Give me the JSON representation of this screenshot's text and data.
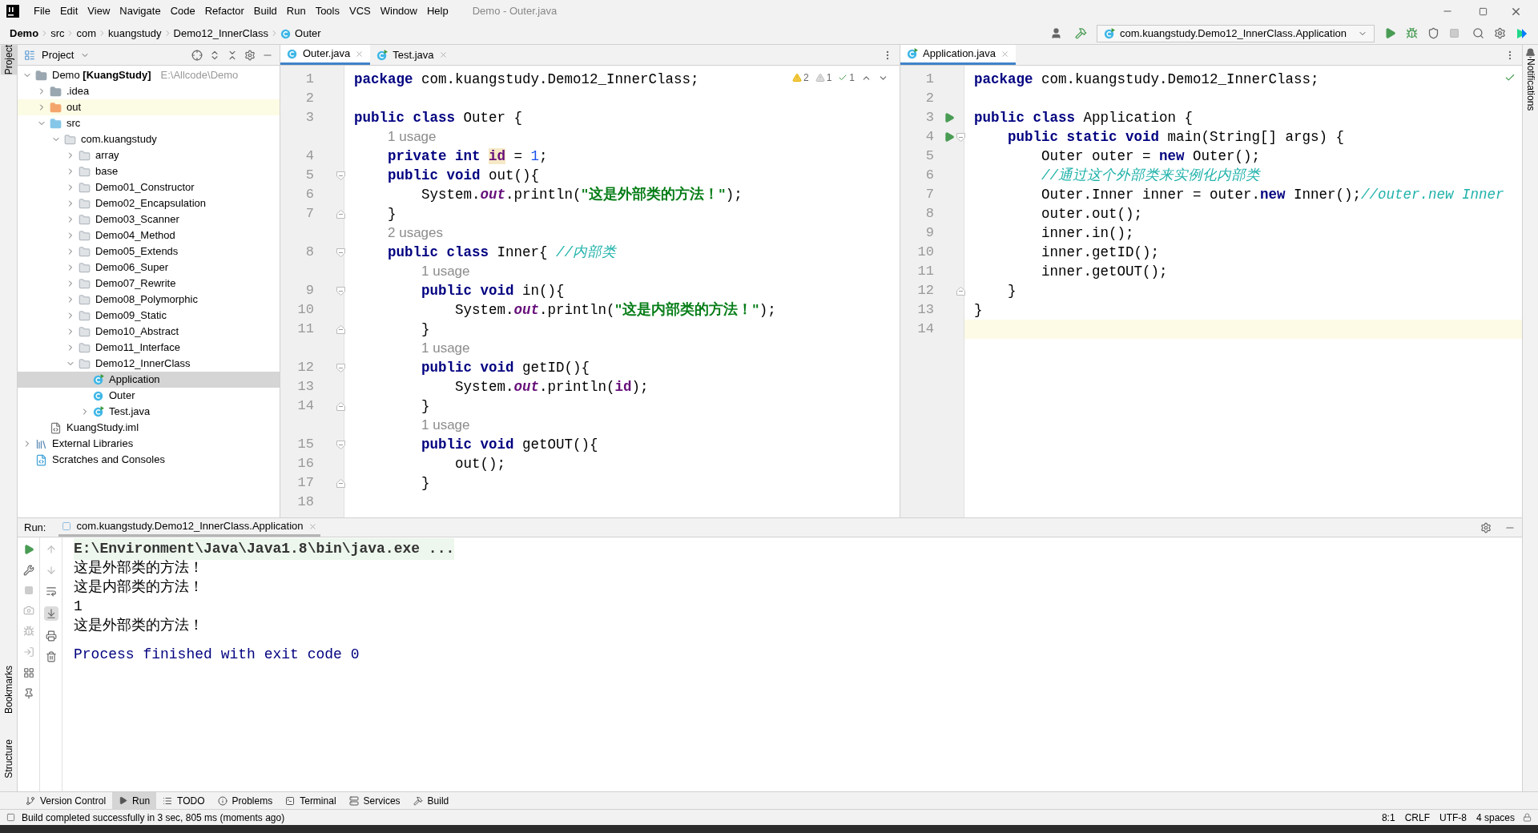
{
  "window": {
    "title": "Demo - Outer.java"
  },
  "menu": [
    "File",
    "Edit",
    "View",
    "Navigate",
    "Code",
    "Refactor",
    "Build",
    "Run",
    "Tools",
    "VCS",
    "Window",
    "Help"
  ],
  "breadcrumbs": [
    {
      "label": "Demo",
      "kind": "project"
    },
    {
      "label": "src",
      "kind": "plain"
    },
    {
      "label": "com",
      "kind": "plain"
    },
    {
      "label": "kuangstudy",
      "kind": "plain"
    },
    {
      "label": "Demo12_InnerClass",
      "kind": "plain"
    },
    {
      "label": "Outer",
      "kind": "class"
    }
  ],
  "run_config": "com.kuangstudy.Demo12_InnerClass.Application",
  "side_tabs": {
    "left_top": [
      {
        "label": "Project",
        "selected": true
      }
    ],
    "left_bottom": [
      {
        "label": "Bookmarks",
        "selected": false
      },
      {
        "label": "Structure",
        "selected": false
      }
    ],
    "right": [
      {
        "label": "Notifications",
        "selected": false
      }
    ]
  },
  "project": {
    "title": "Project",
    "tree": [
      {
        "name": "Demo **[KuangStudy]**",
        "path": "E:\\Allcode\\Demo",
        "kind": "module",
        "expanded": true,
        "selected": false,
        "children": [
          {
            "name": ".idea",
            "kind": "folder",
            "expanded": false,
            "selected": false
          },
          {
            "name": "out",
            "kind": "excluded",
            "expanded": false,
            "selected": false
          },
          {
            "name": "src",
            "kind": "source",
            "expanded": true,
            "selected": false,
            "children": [
              {
                "name": "com.kuangstudy",
                "kind": "package",
                "expanded": true,
                "selected": false,
                "children": [
                  {
                    "name": "array",
                    "kind": "package",
                    "expanded": false,
                    "selected": false
                  },
                  {
                    "name": "base",
                    "kind": "package",
                    "expanded": false,
                    "selected": false
                  },
                  {
                    "name": "Demo01_Constructor",
                    "kind": "package",
                    "expanded": false,
                    "selected": false
                  },
                  {
                    "name": "Demo02_Encapsulation",
                    "kind": "package",
                    "expanded": false,
                    "selected": false
                  },
                  {
                    "name": "Demo03_Scanner",
                    "kind": "package",
                    "expanded": false,
                    "selected": false
                  },
                  {
                    "name": "Demo04_Method",
                    "kind": "package",
                    "expanded": false,
                    "selected": false
                  },
                  {
                    "name": "Demo05_Extends",
                    "kind": "package",
                    "expanded": false,
                    "selected": false
                  },
                  {
                    "name": "Demo06_Super",
                    "kind": "package",
                    "expanded": false,
                    "selected": false
                  },
                  {
                    "name": "Demo07_Rewrite",
                    "kind": "package",
                    "expanded": false,
                    "selected": false
                  },
                  {
                    "name": "Demo08_Polymorphic",
                    "kind": "package",
                    "expanded": false,
                    "selected": false
                  },
                  {
                    "name": "Demo09_Static",
                    "kind": "package",
                    "expanded": false,
                    "selected": false
                  },
                  {
                    "name": "Demo10_Abstract",
                    "kind": "package",
                    "expanded": false,
                    "selected": false
                  },
                  {
                    "name": "Demo11_Interface",
                    "kind": "package",
                    "expanded": false,
                    "selected": false
                  },
                  {
                    "name": "Demo12_InnerClass",
                    "kind": "package",
                    "expanded": true,
                    "selected": false,
                    "children": [
                      {
                        "name": "Application",
                        "kind": "runnable",
                        "selected": true
                      },
                      {
                        "name": "Outer",
                        "kind": "class",
                        "selected": false
                      },
                      {
                        "name": "Test.java",
                        "kind": "runnable",
                        "expanded": false,
                        "selected": false
                      }
                    ]
                  }
                ]
              }
            ]
          },
          {
            "name": "KuangStudy.iml",
            "kind": "iml",
            "selected": false
          }
        ]
      },
      {
        "name": "External Libraries",
        "kind": "libraries",
        "expanded": false,
        "selected": false
      },
      {
        "name": "Scratches and Consoles",
        "kind": "scratches",
        "selected": false
      }
    ]
  },
  "left_editor": {
    "tabs": [
      {
        "label": "Outer.java",
        "kind": "class",
        "selected": true
      },
      {
        "label": "Test.java",
        "kind": "runnable",
        "selected": false
      }
    ],
    "inspections": [
      {
        "kind": "warning",
        "count": "2"
      },
      {
        "kind": "weak",
        "count": "1"
      },
      {
        "kind": "typo",
        "count": "1"
      }
    ],
    "lines": [
      {
        "num": "1",
        "tokens": [
          {
            "text": "package",
            "kind": "kw"
          },
          {
            "text": " com.kuangstudy.Demo12_InnerClass;",
            "kind": "plain"
          }
        ]
      },
      {
        "num": "2"
      },
      {
        "num": "3",
        "tokens": [
          {
            "text": "public class",
            "kind": "kw"
          },
          {
            "text": " Outer {",
            "kind": "plain"
          }
        ]
      },
      {
        "hint": "    1 usage"
      },
      {
        "num": "4",
        "tokens": [
          {
            "text": "    private int ",
            "kind": "kw"
          },
          {
            "text": "id",
            "kind": "fieldhl"
          },
          {
            "text": " = ",
            "kind": "plain"
          },
          {
            "text": "1",
            "kind": "num"
          },
          {
            "text": ";",
            "kind": "plain"
          }
        ]
      },
      {
        "num": "5",
        "fold": {
          "kind": "open"
        },
        "tokens": [
          {
            "text": "    public void",
            "kind": "kw"
          },
          {
            "text": " out(){",
            "kind": "plain"
          }
        ]
      },
      {
        "num": "6",
        "tokens": [
          {
            "text": "        System.",
            "kind": "plain"
          },
          {
            "text": "out",
            "kind": "static"
          },
          {
            "text": ".println(",
            "kind": "plain"
          },
          {
            "text": "\"这是外部类的方法！\"",
            "kind": "str"
          },
          {
            "text": ");",
            "kind": "plain"
          }
        ]
      },
      {
        "num": "7",
        "fold": {
          "kind": "close"
        },
        "tokens": [
          {
            "text": "    }",
            "kind": "plain"
          }
        ]
      },
      {
        "hint": "    2 usages"
      },
      {
        "num": "8",
        "fold": {
          "kind": "open"
        },
        "tokens": [
          {
            "text": "    public class",
            "kind": "kw"
          },
          {
            "text": " Inner{ ",
            "kind": "plain"
          },
          {
            "text": "//内部类",
            "kind": "comment"
          }
        ]
      },
      {
        "hint": "        1 usage"
      },
      {
        "num": "9",
        "fold": {
          "kind": "open"
        },
        "tokens": [
          {
            "text": "        public void",
            "kind": "kw"
          },
          {
            "text": " in(){",
            "kind": "plain"
          }
        ]
      },
      {
        "num": "10",
        "tokens": [
          {
            "text": "            System.",
            "kind": "plain"
          },
          {
            "text": "out",
            "kind": "static"
          },
          {
            "text": ".println(",
            "kind": "plain"
          },
          {
            "text": "\"这是内部类的方法！\"",
            "kind": "str"
          },
          {
            "text": ");",
            "kind": "plain"
          }
        ]
      },
      {
        "num": "11",
        "fold": {
          "kind": "close"
        },
        "tokens": [
          {
            "text": "        }",
            "kind": "plain"
          }
        ]
      },
      {
        "hint": "        1 usage"
      },
      {
        "num": "12",
        "fold": {
          "kind": "open"
        },
        "tokens": [
          {
            "text": "        public void",
            "kind": "kw"
          },
          {
            "text": " getID(){",
            "kind": "plain"
          }
        ]
      },
      {
        "num": "13",
        "tokens": [
          {
            "text": "            System.",
            "kind": "plain"
          },
          {
            "text": "out",
            "kind": "static"
          },
          {
            "text": ".println(",
            "kind": "plain"
          },
          {
            "text": "id",
            "kind": "field"
          },
          {
            "text": ");",
            "kind": "plain"
          }
        ]
      },
      {
        "num": "14",
        "fold": {
          "kind": "close"
        },
        "tokens": [
          {
            "text": "        }",
            "kind": "plain"
          }
        ]
      },
      {
        "hint": "        1 usage"
      },
      {
        "num": "15",
        "fold": {
          "kind": "open"
        },
        "tokens": [
          {
            "text": "        public void",
            "kind": "kw"
          },
          {
            "text": " getOUT(){",
            "kind": "plain"
          }
        ]
      },
      {
        "num": "16",
        "tokens": [
          {
            "text": "            out();",
            "kind": "plain"
          }
        ]
      },
      {
        "num": "17",
        "fold": {
          "kind": "close"
        },
        "tokens": [
          {
            "text": "        }",
            "kind": "plain"
          }
        ]
      },
      {
        "num": "18"
      }
    ]
  },
  "right_editor": {
    "tabs": [
      {
        "label": "Application.java",
        "kind": "runnable",
        "selected": true
      }
    ],
    "lines": [
      {
        "num": "1",
        "tokens": [
          {
            "text": "package",
            "kind": "kw"
          },
          {
            "text": " com.kuangstudy.Demo12_InnerClass;",
            "kind": "plain"
          }
        ]
      },
      {
        "num": "2"
      },
      {
        "num": "3",
        "run": true,
        "tokens": [
          {
            "text": "public class",
            "kind": "kw"
          },
          {
            "text": " Application {",
            "kind": "plain"
          }
        ]
      },
      {
        "num": "4",
        "run": true,
        "fold": {
          "kind": "open"
        },
        "tokens": [
          {
            "text": "    public static void",
            "kind": "kw"
          },
          {
            "text": " main(String[] args) {",
            "kind": "plain"
          }
        ]
      },
      {
        "num": "5",
        "tokens": [
          {
            "text": "        Outer outer = ",
            "kind": "plain"
          },
          {
            "text": "new",
            "kind": "kw"
          },
          {
            "text": " Outer();",
            "kind": "plain"
          }
        ]
      },
      {
        "num": "6",
        "tokens": [
          {
            "text": "        //通过这个外部类来实例化内部类",
            "kind": "comment"
          }
        ]
      },
      {
        "num": "7",
        "tokens": [
          {
            "text": "        Outer.Inner inner = outer.",
            "kind": "plain"
          },
          {
            "text": "new",
            "kind": "kw"
          },
          {
            "text": " Inner();",
            "kind": "plain"
          },
          {
            "text": "//outer.new Inner",
            "kind": "comment"
          }
        ]
      },
      {
        "num": "8",
        "tokens": [
          {
            "text": "        outer.out();",
            "kind": "plain"
          }
        ]
      },
      {
        "num": "9",
        "tokens": [
          {
            "text": "        inner.in();",
            "kind": "plain"
          }
        ]
      },
      {
        "num": "10",
        "tokens": [
          {
            "text": "        inner.getID();",
            "kind": "plain"
          }
        ]
      },
      {
        "num": "11",
        "tokens": [
          {
            "text": "        inner.getOUT();",
            "kind": "plain"
          }
        ]
      },
      {
        "num": "12",
        "fold": {
          "kind": "close"
        },
        "tokens": [
          {
            "text": "    }",
            "kind": "plain"
          }
        ]
      },
      {
        "num": "13",
        "tokens": [
          {
            "text": "}",
            "kind": "plain"
          }
        ]
      },
      {
        "num": "14",
        "current": true
      }
    ]
  },
  "run_panel": {
    "label": "Run:",
    "tab": "com.kuangstudy.Demo12_InnerClass.Application",
    "output": [
      {
        "kind": "command",
        "text": "E:\\Environment\\Java\\Java1.8\\bin\\java.exe ..."
      },
      {
        "kind": "stdout",
        "text": "这是外部类的方法！"
      },
      {
        "kind": "stdout",
        "text": "这是内部类的方法！"
      },
      {
        "kind": "stdout",
        "text": "1"
      },
      {
        "kind": "stdout",
        "text": "这是外部类的方法！"
      },
      {
        "kind": "exit",
        "text": "Process finished with exit code 0"
      }
    ]
  },
  "tool_tabs": [
    {
      "label": "Version Control",
      "kind": "vcs",
      "selected": false
    },
    {
      "label": "Run",
      "kind": "run",
      "selected": true
    },
    {
      "label": "TODO",
      "kind": "todo",
      "selected": false
    },
    {
      "label": "Problems",
      "kind": "problems",
      "selected": false
    },
    {
      "label": "Terminal",
      "kind": "terminal",
      "selected": false
    },
    {
      "label": "Services",
      "kind": "services",
      "selected": false
    },
    {
      "label": "Build",
      "kind": "build",
      "selected": false
    }
  ],
  "status_bar": {
    "message": "Build completed successfully in 3 sec, 805 ms (moments ago)",
    "items": [
      "8:1",
      "CRLF",
      "UTF-8",
      "4 spaces"
    ]
  }
}
